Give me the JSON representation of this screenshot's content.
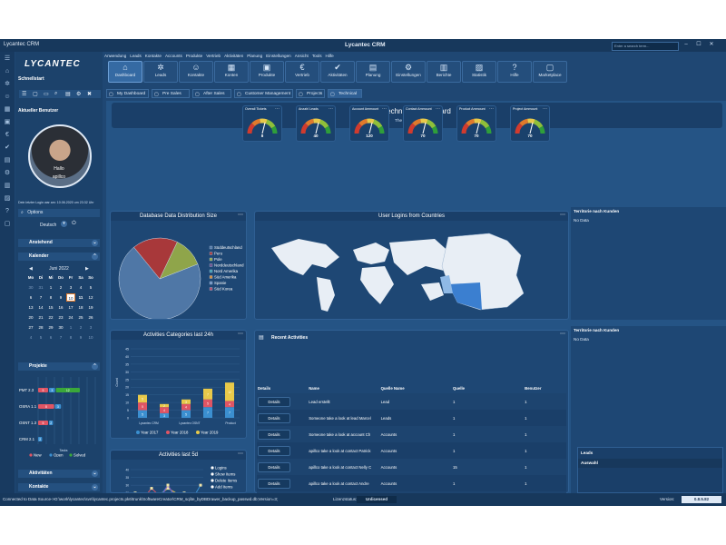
{
  "app": {
    "title": "Lycantec CRM",
    "window_title": "Lycantec CRM",
    "search_placeholder": "Enter a search term..."
  },
  "menu": [
    "Anwendung",
    "Leads",
    "Kontakte",
    "Accounts",
    "Produkte",
    "Vertrieb",
    "Aktivitäten",
    "Planung",
    "Einstellungen",
    "Ansicht",
    "Tools",
    "Hilfe"
  ],
  "ribbon": [
    {
      "label": "Dashboard",
      "icon": "home-icon"
    },
    {
      "label": "Leads",
      "icon": "network-icon"
    },
    {
      "label": "Kontakte",
      "icon": "contacts-icon"
    },
    {
      "label": "Konten",
      "icon": "building-icon"
    },
    {
      "label": "Produkte",
      "icon": "box-icon"
    },
    {
      "label": "Vertrieb",
      "icon": "sales-icon"
    },
    {
      "label": "Aktivitäten",
      "icon": "activities-icon"
    },
    {
      "label": "Planung",
      "icon": "planning-icon"
    },
    {
      "label": "Einstellungen",
      "icon": "settings-icon"
    },
    {
      "label": "Berichte",
      "icon": "reports-icon"
    },
    {
      "label": "Statistik",
      "icon": "statistics-icon"
    },
    {
      "label": "Hilfe",
      "icon": "help-icon"
    },
    {
      "label": "Marketplace",
      "icon": "marketplace-icon"
    }
  ],
  "tabs": [
    "My Dashboard",
    "Pre Sales",
    "After Sales",
    "Customer Management",
    "Projects",
    "Technical"
  ],
  "sidebar": {
    "logo": "LYCANTEC",
    "quickstart": "Schnellstart",
    "current_user": "Aktueller Benutzer",
    "greeting": "Hallo",
    "username": "apillco",
    "last_login": "Dein letzter Login war am:   10.06.2020 um 23:32 Uhr",
    "options": "Options",
    "language": "Deutsch",
    "sections": {
      "upcoming": "Anstehend",
      "calendar": "Kalender",
      "projects": "Projekte",
      "activities": "Aktivitäten",
      "contacts": "Kontakte"
    },
    "calendar": {
      "month": "Juni 2022",
      "weekdays": [
        "Mo",
        "Di",
        "Mi",
        "Do",
        "Fr",
        "Sa",
        "So"
      ],
      "weeks": [
        [
          "30",
          "31",
          "1",
          "2",
          "3",
          "4",
          "5"
        ],
        [
          "6",
          "7",
          "8",
          "9",
          "10",
          "11",
          "12"
        ],
        [
          "13",
          "14",
          "15",
          "16",
          "17",
          "18",
          "19"
        ],
        [
          "20",
          "21",
          "22",
          "23",
          "24",
          "25",
          "26"
        ],
        [
          "27",
          "28",
          "29",
          "30",
          "1",
          "2",
          "3"
        ],
        [
          "4",
          "5",
          "6",
          "7",
          "8",
          "9",
          "10"
        ]
      ],
      "today": "10",
      "selected": "11"
    },
    "projects_chart": {
      "rows": [
        "PMT 2.3",
        "OSRA 1.1",
        "OSNT 1.3",
        "CRM 2.1"
      ],
      "legend": [
        "New",
        "Open",
        "Solved"
      ],
      "axis_label": "Tasks",
      "values": [
        {
          "new": 5,
          "open": 3,
          "solved": 12
        },
        {
          "new": 8,
          "open": 3,
          "solved": 0
        },
        {
          "new": 5,
          "open": 2,
          "solved": 0
        },
        {
          "new": 0,
          "open": 2,
          "solved": 0
        }
      ]
    }
  },
  "dashboard": {
    "title": "Technical Dashboard",
    "subtitle": "The Technical Overview",
    "gauges": [
      {
        "label": "Overall Tickets",
        "value": "8"
      },
      {
        "label": "Anzahl Leads",
        "value": "40"
      },
      {
        "label": "Account Ammount",
        "value": "120"
      },
      {
        "label": "Contact Ammount",
        "value": "70"
      },
      {
        "label": "Product Ammount",
        "value": "70"
      },
      {
        "label": "Project Ammount",
        "value": "70"
      }
    ],
    "db_panel": {
      "title": "Database Data Distribution Size",
      "chart_data": {
        "type": "pie",
        "labels": [
          "Süddeutschland",
          "Peru",
          "Pole",
          "Norddeutschland",
          "Nord Amerika",
          "Süd Amerika",
          "Spanie",
          "Süd Korea"
        ],
        "values": [
          70,
          18,
          12,
          0,
          0,
          0,
          0,
          0
        ],
        "colors": [
          "#4f77a6",
          "#a8383a",
          "#8fa54a",
          "#6a4d8c",
          "#3a9bb0",
          "#d08a3c",
          "#6a8fbf",
          "#b04a6a"
        ]
      }
    },
    "map_panel": {
      "title": "User Logins from Countries"
    },
    "territory1": {
      "title": "Territorie nach Kunden",
      "body": "No Data"
    },
    "territory2": {
      "title": "Territorie nach Kunden",
      "body": "No Data"
    },
    "activities24": {
      "title": "Activities Categories last 24h",
      "chart_data": {
        "type": "bar",
        "categories": [
          "Lycantec CRM",
          "Lycantec OSNT",
          "Product"
        ],
        "series": [
          {
            "name": "Year 2017",
            "values": [
              5,
              3,
              5,
              7,
              7
            ]
          },
          {
            "name": "Year 2018",
            "values": [
              5,
              4,
              4,
              5,
              4
            ]
          },
          {
            "name": "Year 2019",
            "values": [
              5,
              2,
              3,
              7,
              12
            ]
          }
        ],
        "ylabel": "Count",
        "ylim": [
          0,
          45
        ],
        "yticks": [
          "0",
          "5",
          "10",
          "15",
          "20",
          "25",
          "30",
          "35",
          "40",
          "45"
        ]
      }
    },
    "activities5d": {
      "title": "Activities last 5d",
      "chart_data": {
        "type": "line",
        "legend": [
          "Logins",
          "Show Items",
          "Delete Items",
          "Add Items"
        ],
        "yticks": [
          "5",
          "10",
          "15",
          "20",
          "25",
          "30",
          "35",
          "40"
        ],
        "series": [
          {
            "name": "Logins",
            "values": [
              10,
              20,
              28,
              22,
              10
            ]
          },
          {
            "name": "Show Items",
            "values": [
              25,
              15,
              30,
              12,
              30
            ]
          },
          {
            "name": "Delete Items",
            "values": [
              15,
              28,
              18,
              25,
              15
            ]
          },
          {
            "name": "Add Items",
            "values": [
              8,
              12,
              30,
              14,
              20
            ]
          }
        ]
      }
    },
    "recent": {
      "title": "Recent Activities",
      "headers": [
        "Details",
        "Name",
        "Quelle Name",
        "Quelle",
        "Benutzer"
      ],
      "button": "Details",
      "rows": [
        {
          "name": "Lead erstellt",
          "src": "Lead",
          "q": "1",
          "u": "1"
        },
        {
          "name": "Someone take a look at lead Marcel",
          "src": "Leads",
          "q": "1",
          "u": "1"
        },
        {
          "name": "Someone take a look at account Ch",
          "src": "Accounts",
          "q": "1",
          "u": "1"
        },
        {
          "name": "apillco take a look at contact Patrick",
          "src": "Accounts",
          "q": "1",
          "u": "1"
        },
        {
          "name": "apillco take a look at contact Nelly C",
          "src": "Accounts",
          "q": "15",
          "u": "1"
        },
        {
          "name": "apillco take a look at contact Andre",
          "src": "Accounts",
          "q": "1",
          "u": "1"
        },
        {
          "name": "apillco take a look at contact Andre",
          "src": "Accounts",
          "q": "1",
          "u": "1"
        },
        {
          "name": "apillco take a look at contact Jonath",
          "src": "Accounts",
          "q": "15",
          "u": "1"
        }
      ]
    },
    "leads_panel": {
      "title": "Leads",
      "row": "Auswahl"
    }
  },
  "status": {
    "connection": "Connected to Data Source->D:\\work\\lycantec\\svn\\lycantec.projects.pk6\\trunk\\SoftwareCreator\\CRM_sqlite_byDBDrawer_backup_passwd.db;Version=3;",
    "license_label": "Lizenzstatus:",
    "license_value": "Unlicensed",
    "version_label": "Version:",
    "version_value": "0.8.5.82"
  }
}
